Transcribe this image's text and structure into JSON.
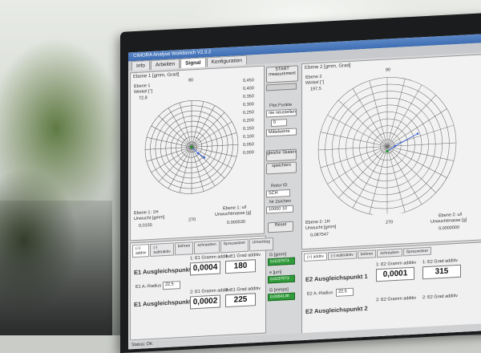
{
  "window": {
    "title": "CIMORA Analyse Workbench V2.3.2"
  },
  "tabs": [
    {
      "label": "Info",
      "active": false
    },
    {
      "label": "Arbeiten",
      "active": false
    },
    {
      "label": "Signal",
      "active": true
    },
    {
      "label": "Konfiguration",
      "active": false
    }
  ],
  "plane1": {
    "title": "Ebene 1 [gmm, Grad]",
    "info_label": "Ebene 1",
    "angle_label": "Winkel [°]",
    "angle_value": "72,8",
    "scale_top": "80",
    "scale": [
      "0,450",
      "0,400",
      "0,350",
      "0,300",
      "0,250",
      "0,200",
      "0,150",
      "0,100",
      "0,050",
      "0,000"
    ],
    "bottom_left_label": "Ebene 1: 1H",
    "bottom_left_sub": "Unwucht [gmm]",
    "bottom_left_value": "0,0155",
    "bottom_right_label": "Ebene 1: u/l",
    "bottom_right_sub": "Unwuchtmasse [g]",
    "bottom_right_value": "0,000530",
    "bottom_angle": "270"
  },
  "plane2": {
    "title": "Ebene 2 [gmm, Grad]",
    "info_label": "Ebene 2",
    "angle_label": "Winkel [°]",
    "angle_value": "197,5",
    "scale_top": "90",
    "bottom_left_label": "Ebene 2: 1H",
    "bottom_left_sub": "Unwucht [gmm]",
    "bottom_left_value": "0,087547",
    "bottom_right_label": "Ebene 2: u/l",
    "bottom_right_sub": "Unwuchtmasse [g]",
    "bottom_right_value": "0,0000000",
    "bottom_angle": "270"
  },
  "controls": {
    "start_button": "START measurement",
    "plot_label": "Plot Punkte",
    "plot_field": "nie neustellen",
    "plot_number": "0",
    "mittelwerte": "Mittelwerte",
    "gleiche_button": "gleiche Skalen",
    "speichern_button": "speichern",
    "rotor_label": "Rotor ID",
    "rotor_value": "SCH",
    "nr_label": "Nr Zeichen",
    "nr_value": "10000 10",
    "reset_button": "Reset"
  },
  "bottom1": {
    "tabs": [
      "(+) addtiv",
      "(-) subtraktiv",
      "bohren",
      "schrauben",
      "Sprezwinkel",
      "Umschlag"
    ],
    "title1": "E1 Ausgleichspunkt 1",
    "title2": "E1 Ausgleichspunkt 2",
    "radius_label": "E1 A.-Radius",
    "radius_value": "22,5",
    "gram_label_1": "1: E1 Gramm additiv",
    "gram_value_1": "0,0004",
    "grad_label_1": "1: E1 Grad additiv",
    "grad_value_1": "180",
    "gram_label_2": "2: E1 Gramm additiv",
    "gram_value_2": "0,0002",
    "grad_label_2": "2: E1 Grad additiv",
    "grad_value_2": "225"
  },
  "mid_values": {
    "g_label": "G [gmm]",
    "g_value": "0,0237873",
    "e_label": "e [µm]",
    "e_value": "0,0237873",
    "q_label": "G [mmps]",
    "q_value": "0,0064138"
  },
  "bottom2": {
    "tabs": [
      "(+) addtiv",
      "(-) subtraktiv",
      "bohren",
      "schrauben",
      "Sprezwinkel"
    ],
    "title1": "E2 Ausgleichspunkt 1",
    "title2": "E2 Ausgleichspunkt 2",
    "radius_label": "E2 A.-Radius",
    "radius_value": "22,5",
    "gram_label_1": "1: E2 Gramm additiv",
    "gram_value_1": "0,0001",
    "grad_label_1": "1: E2 Grad additiv",
    "grad_value_1": "315",
    "gram_label_2": "2: E2 Gramm additiv",
    "grad_label_2": "2: E2 Grad additiv"
  },
  "status": {
    "text": "Status: OK"
  }
}
